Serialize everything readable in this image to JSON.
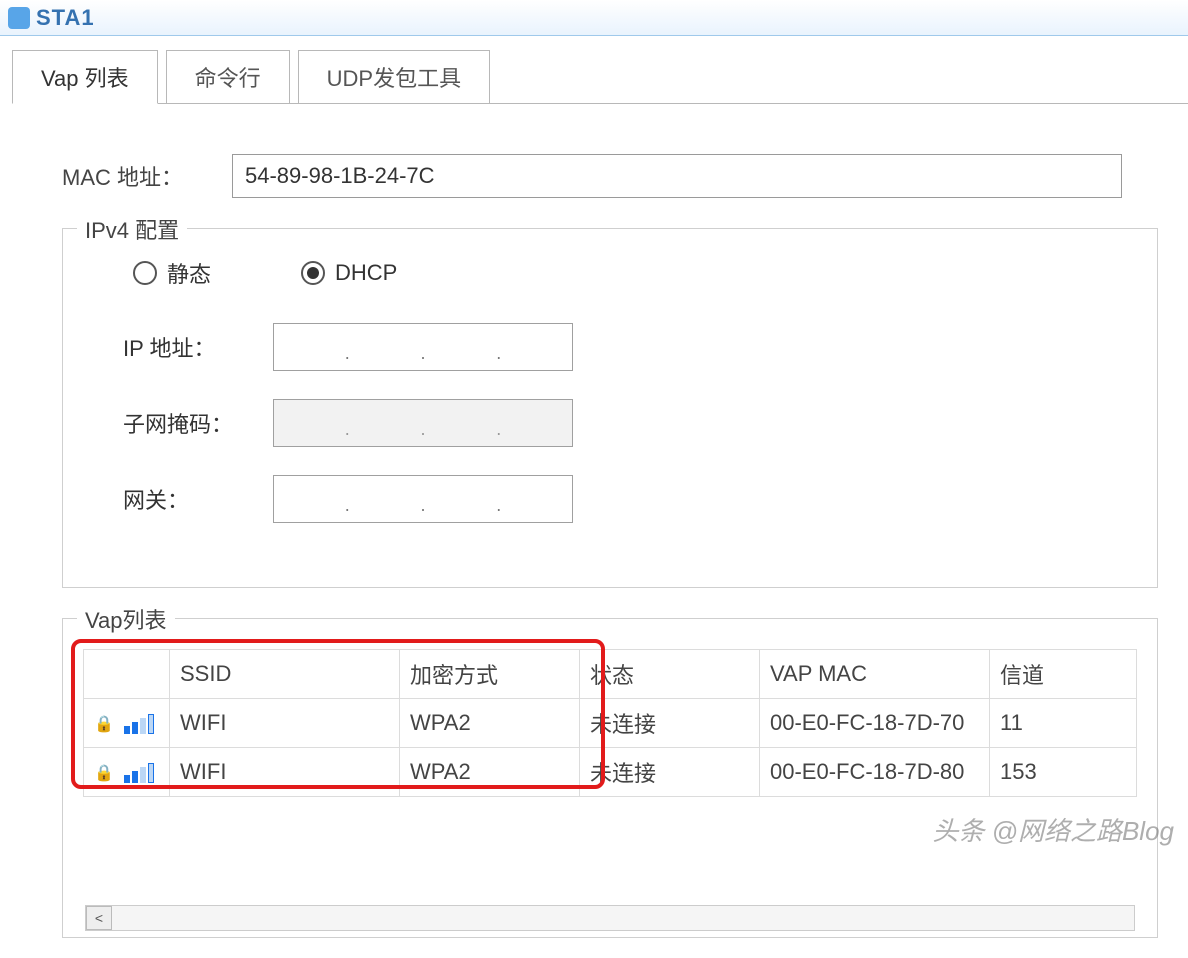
{
  "window": {
    "title": "STA1"
  },
  "tabs": [
    {
      "label": "Vap 列表",
      "active": true
    },
    {
      "label": "命令行",
      "active": false
    },
    {
      "label": "UDP发包工具",
      "active": false
    }
  ],
  "mac": {
    "label": "MAC 地址：",
    "value": "54-89-98-1B-24-7C"
  },
  "ipv4": {
    "legend": "IPv4 配置",
    "static_label": "静态",
    "dhcp_label": "DHCP",
    "selected": "DHCP",
    "ip_label": "IP 地址：",
    "mask_label": "子网掩码：",
    "gateway_label": "网关：",
    "ip_placeholder": ".   .   .",
    "mask_placeholder": ".   .   .",
    "gateway_placeholder": ".   .   ."
  },
  "vap": {
    "legend": "Vap列表",
    "columns": {
      "icon": "",
      "ssid": "SSID",
      "encryption": "加密方式",
      "status": "状态",
      "vapmac": "VAP MAC",
      "channel": "信道"
    },
    "rows": [
      {
        "ssid": "WIFI",
        "encryption": "WPA2",
        "status": "未连接",
        "vapmac": "00-E0-FC-18-7D-70",
        "channel": "11"
      },
      {
        "ssid": "WIFI",
        "encryption": "WPA2",
        "status": "未连接",
        "vapmac": "00-E0-FC-18-7D-80",
        "channel": "153"
      }
    ]
  },
  "watermark": "头条 @网络之路Blog"
}
